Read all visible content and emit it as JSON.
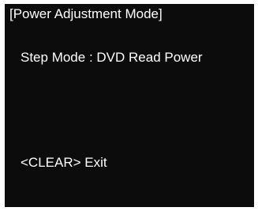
{
  "screen": {
    "title": "[Power Adjustment Mode]",
    "step_mode_line": "Step Mode : DVD Read Power",
    "exit_line": "<CLEAR> Exit"
  },
  "colors": {
    "screen_background": "#0c0c0c",
    "text": "#ffffff"
  }
}
